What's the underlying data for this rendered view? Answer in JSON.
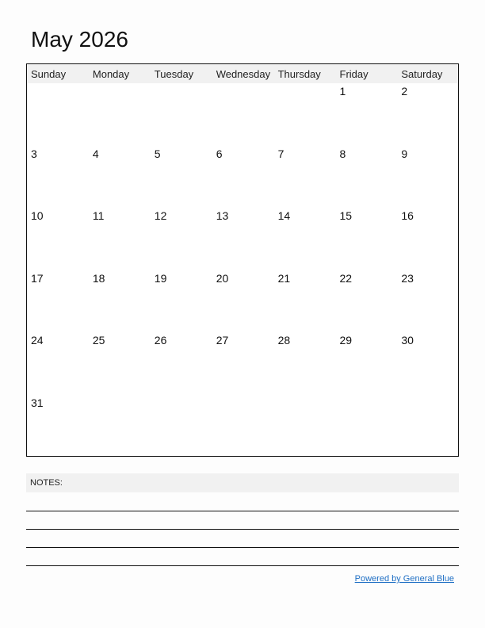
{
  "title": "May 2026",
  "weekdays": [
    "Sunday",
    "Monday",
    "Tuesday",
    "Wednesday",
    "Thursday",
    "Friday",
    "Saturday"
  ],
  "weeks": [
    [
      "",
      "",
      "",
      "",
      "",
      "1",
      "2"
    ],
    [
      "3",
      "4",
      "5",
      "6",
      "7",
      "8",
      "9"
    ],
    [
      "10",
      "11",
      "12",
      "13",
      "14",
      "15",
      "16"
    ],
    [
      "17",
      "18",
      "19",
      "20",
      "21",
      "22",
      "23"
    ],
    [
      "24",
      "25",
      "26",
      "27",
      "28",
      "29",
      "30"
    ],
    [
      "31",
      "",
      "",
      "",
      "",
      "",
      ""
    ]
  ],
  "notes": {
    "label": "NOTES:",
    "line_count": 4
  },
  "footer": {
    "powered_by": "Powered by General Blue"
  },
  "colors": {
    "link": "#1f6fc4",
    "header_bg": "#f1f1f1"
  }
}
